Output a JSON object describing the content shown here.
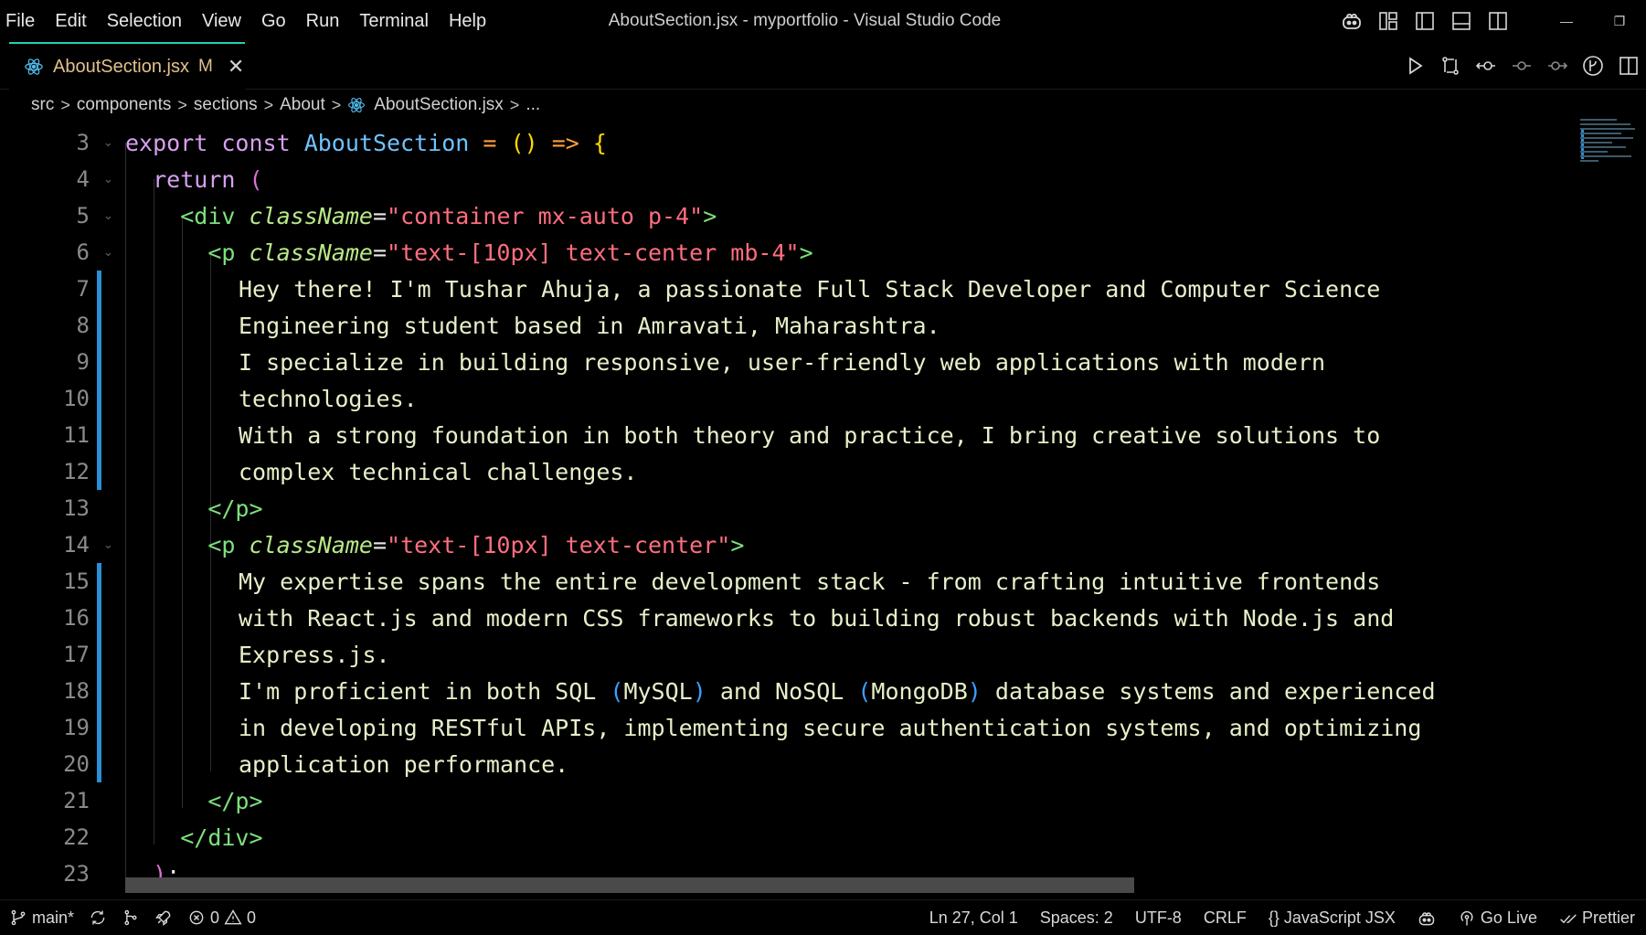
{
  "menu": [
    "File",
    "Edit",
    "Selection",
    "View",
    "Go",
    "Run",
    "Terminal",
    "Help"
  ],
  "window_title": "AboutSection.jsx - myportfolio - Visual Studio Code",
  "window_controls": {
    "minimize": "—",
    "restore": "❐"
  },
  "tab": {
    "label": "AboutSection.jsx",
    "modified": "M",
    "close": "✕"
  },
  "breadcrumb": {
    "items": [
      "src",
      "components",
      "sections",
      "About",
      "AboutSection.jsx",
      "..."
    ],
    "separator": ">"
  },
  "editor": {
    "lines": [
      {
        "num": "3",
        "indent": 0
      },
      {
        "num": "4",
        "indent": 1
      },
      {
        "num": "5",
        "indent": 2
      },
      {
        "num": "6",
        "indent": 3
      },
      {
        "num": "7",
        "indent": 4,
        "text": "Hey there! I'm Tushar Ahuja, a passionate Full Stack Developer and Computer Science"
      },
      {
        "num": "8",
        "indent": 4,
        "text": "Engineering student based in Amravati, Maharashtra."
      },
      {
        "num": "9",
        "indent": 4,
        "text": "I specialize in building responsive, user-friendly web applications with modern"
      },
      {
        "num": "10",
        "indent": 4,
        "text": "technologies."
      },
      {
        "num": "11",
        "indent": 4,
        "text": "With a strong foundation in both theory and practice, I bring creative solutions to"
      },
      {
        "num": "12",
        "indent": 4,
        "text": "complex technical challenges."
      },
      {
        "num": "13",
        "indent": 3
      },
      {
        "num": "14",
        "indent": 3
      },
      {
        "num": "15",
        "indent": 4,
        "text": "My expertise spans the entire development stack - from crafting intuitive frontends"
      },
      {
        "num": "16",
        "indent": 4,
        "text": "with React.js and modern CSS frameworks to building robust backends with Node.js and"
      },
      {
        "num": "17",
        "indent": 4,
        "text": "Express.js."
      },
      {
        "num": "18",
        "indent": 4
      },
      {
        "num": "19",
        "indent": 4,
        "text": "in developing RESTful APIs, implementing secure authentication systems, and optimizing"
      },
      {
        "num": "20",
        "indent": 4,
        "text": "application performance."
      },
      {
        "num": "21",
        "indent": 3
      },
      {
        "num": "22",
        "indent": 2
      },
      {
        "num": "23",
        "indent": 1
      }
    ],
    "tokens": {
      "export": "export",
      "const": "const",
      "component": "AboutSection",
      "assign": "=",
      "parens": "()",
      "arrow": "=>",
      "brace_open": "{",
      "return": "return",
      "paren_open": "(",
      "paren_close": ")",
      "semicolon": ";",
      "div_open": "<div",
      "div_close": "</div>",
      "p_open": "<p",
      "p_close": "</p>",
      "classname": "className",
      "gt": ">",
      "div_class": "\"container mx-auto p-4\"",
      "p1_class": "\"text-[10px] text-center mb-4\"",
      "p2_class": "\"text-[10px] text-center\"",
      "l18_a": "I'm proficient in both SQL ",
      "l18_b": "MySQL",
      "l18_c": " and NoSQL ",
      "l18_d": "MongoDB",
      "l18_e": " database systems and experienced"
    }
  },
  "statusbar": {
    "branch": "main*",
    "errors": "0",
    "warnings": "0",
    "position": "Ln 27, Col 1",
    "spaces": "Spaces: 2",
    "encoding": "UTF-8",
    "eol": "CRLF",
    "language_braces": "{}",
    "language": "JavaScript JSX",
    "go_live": "Go Live",
    "prettier": "Prettier"
  },
  "colors": {
    "background": "#000000",
    "accent": "#25d0b0",
    "modified_gutter": "#2a8fd6",
    "tab_label": "#e2c08d",
    "keyword": "#d7a0f0",
    "function": "#6fc3ff",
    "tag": "#7ee07e",
    "string": "#ff6e7f"
  },
  "icons": [
    "copilot-icon",
    "customize-layout-icon",
    "toggle-primary-sidebar-icon",
    "toggle-panel-icon",
    "toggle-secondary-sidebar-icon",
    "react-icon",
    "run-icon",
    "compare-changes-icon",
    "git-back-icon",
    "git-commit-icon",
    "git-forward-icon",
    "git-graph-icon",
    "split-editor-icon",
    "branch-icon",
    "sync-icon",
    "source-control-icon",
    "rocket-icon",
    "error-icon",
    "warning-icon",
    "broadcast-icon",
    "check-double-icon"
  ]
}
